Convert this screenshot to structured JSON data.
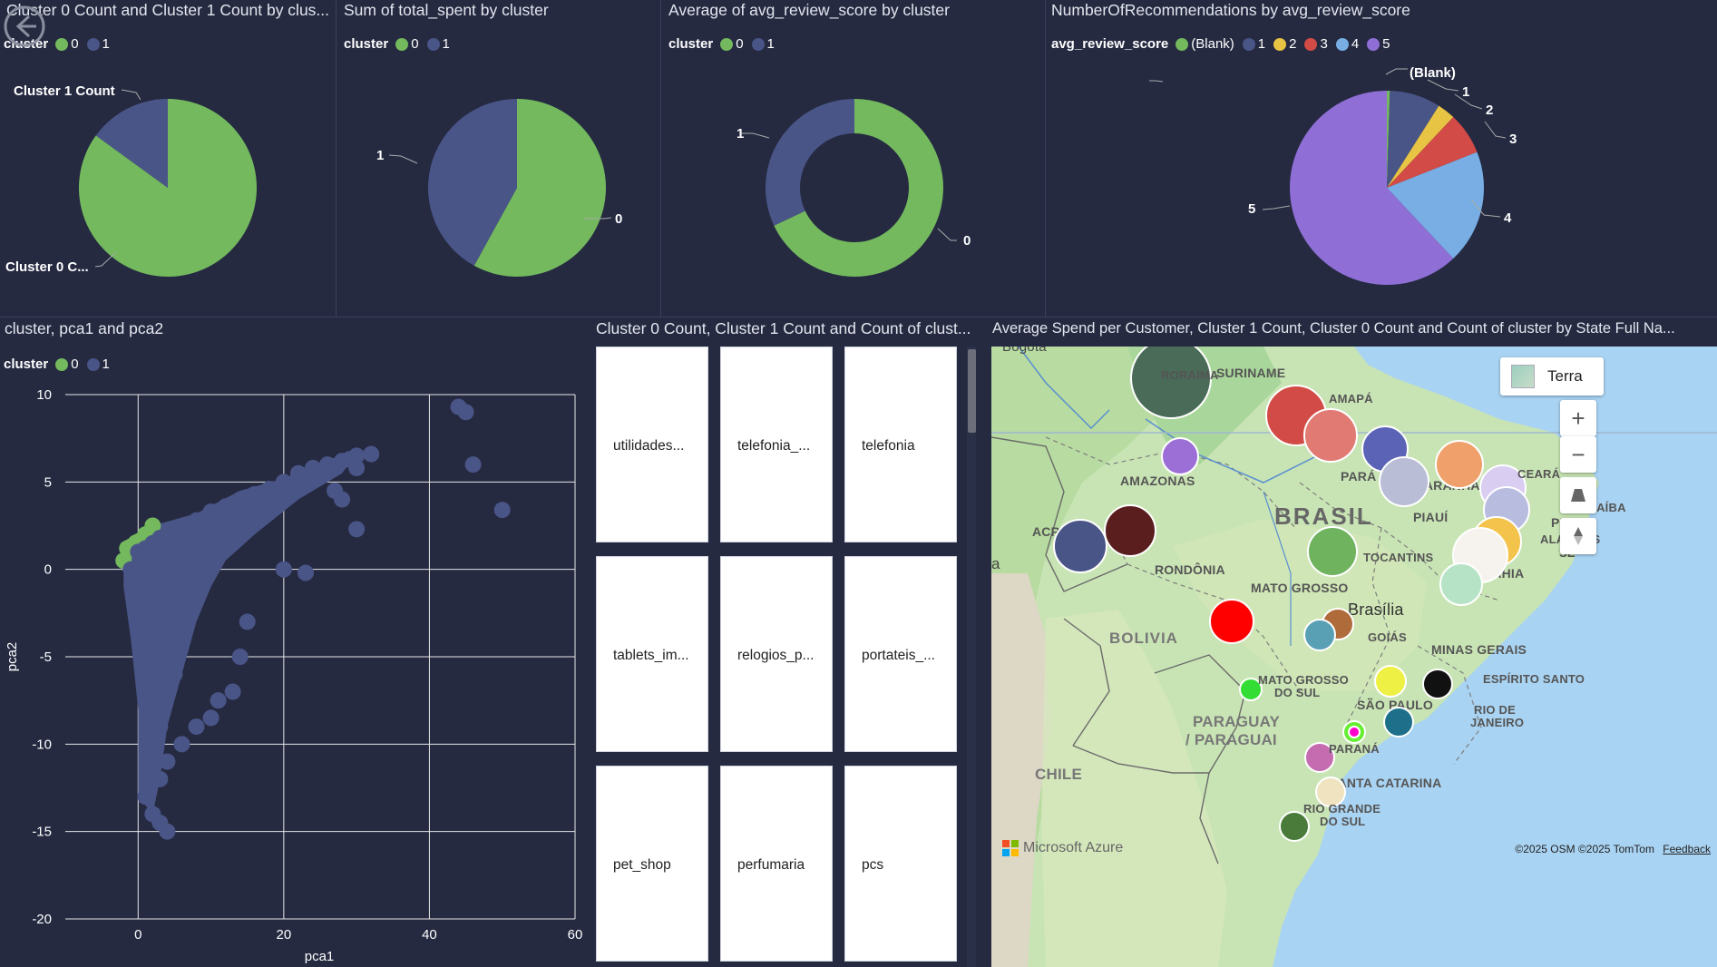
{
  "panel1": {
    "title": "Cluster 0 Count and Cluster 1 Count by clus...",
    "legend_title": "cluster",
    "legend": [
      {
        "label": "0",
        "color": "#74b95e"
      },
      {
        "label": "1",
        "color": "#4a5587"
      }
    ],
    "label_top": "Cluster 1 Count",
    "label_bottom": "Cluster 0 C..."
  },
  "panel2": {
    "title": "Sum of total_spent by cluster",
    "legend_title": "cluster",
    "legend": [
      {
        "label": "0",
        "color": "#74b95e"
      },
      {
        "label": "1",
        "color": "#4a5587"
      }
    ],
    "label_left": "1",
    "label_right": "0"
  },
  "panel3": {
    "title": "Average of avg_review_score by cluster",
    "legend_title": "cluster",
    "legend": [
      {
        "label": "0",
        "color": "#74b95e"
      },
      {
        "label": "1",
        "color": "#4a5587"
      }
    ],
    "label_left": "1",
    "label_right": "0"
  },
  "panel4": {
    "title": "NumberOfRecommendations by avg_review_score",
    "legend_title": "avg_review_score",
    "legend": [
      {
        "label": "(Blank)",
        "color": "#74b95e"
      },
      {
        "label": "1",
        "color": "#4a5587"
      },
      {
        "label": "2",
        "color": "#e8c444"
      },
      {
        "label": "3",
        "color": "#d24b46"
      },
      {
        "label": "4",
        "color": "#78aee3"
      },
      {
        "label": "5",
        "color": "#8f6fd6"
      }
    ],
    "labels": [
      "(Blank)",
      "1",
      "2",
      "3",
      "4",
      "5"
    ]
  },
  "scatter": {
    "title": "cluster, pca1 and pca2",
    "legend_title": "cluster",
    "legend": [
      {
        "label": "0",
        "color": "#74b95e"
      },
      {
        "label": "1",
        "color": "#4a5587"
      }
    ]
  },
  "cards": {
    "title": "Cluster 0 Count, Cluster 1 Count and Count of clust...",
    "items": [
      "utilidades...",
      "telefonia_...",
      "telefonia",
      "tablets_im...",
      "relogios_p...",
      "portateis_...",
      "pet_shop",
      "perfumaria",
      "pcs"
    ]
  },
  "map": {
    "title": "Average Spend per Customer, Cluster 1 Count, Cluster 0 Count and Count of cluster by State Full Na...",
    "style_button": "Terra",
    "zoom_in": "+",
    "zoom_out": "−",
    "attribution": "©2025 OSM  ©2025 TomTom",
    "feedback": "Feedback",
    "logo": "Microsoft Azure",
    "place_labels": {
      "bogota": "Bogotá",
      "suriname": "SURINAME",
      "roraima": "RORAIMA",
      "amapa": "AMAPÁ",
      "amazonas": "AMAZONAS",
      "para": "PARÁ",
      "maranhao": "MARANHÃO",
      "ceara": "CEARÁ",
      "paraiba": "PARAÍBA",
      "brasil": "BRASIL",
      "piaui": "PIAUÍ",
      "pe": "PE",
      "alagoas": "ALAGOAS",
      "se": "SE",
      "acre": "ACRE",
      "rondonia": "RONDÔNIA",
      "tocantins": "TOCANTINS",
      "bahia": "BAHIA",
      "mato_grosso": "MATO GROSSO",
      "brasilia": "Brasília",
      "goias": "GOIÁS",
      "bolivia": "BOLIVIA",
      "minas": "MINAS GERAIS",
      "ms1": "MATO GROSSO",
      "ms2": "DO SUL",
      "espirito": "ESPÍRITO SANTO",
      "sao_paulo": "SÃO PAULO",
      "rj1": "RIO DE",
      "rj2": "JANEIRO",
      "paraguay1": "PARAGUAY",
      "paraguay2": "/ PARAGUAI",
      "parana": "PARANÁ",
      "chile": "CHILE",
      "santa_catarina": "SANTA CATARINA",
      "rgs1": "RIO GRANDE",
      "rgs2": "DO SUL",
      "a": "a"
    }
  },
  "chart_data": [
    {
      "type": "pie",
      "title": "Cluster 0 Count and Cluster 1 Count by clus...",
      "slices": [
        {
          "label": "Cluster 0 Count",
          "value": 85
        },
        {
          "label": "Cluster 1 Count",
          "value": 15
        }
      ]
    },
    {
      "type": "pie",
      "title": "Sum of total_spent by cluster",
      "slices": [
        {
          "label": "0",
          "value": 58
        },
        {
          "label": "1",
          "value": 42
        }
      ]
    },
    {
      "type": "pie",
      "title": "Average of avg_review_score by cluster",
      "slices": [
        {
          "label": "0",
          "value": 68
        },
        {
          "label": "1",
          "value": 32
        }
      ]
    },
    {
      "type": "pie",
      "title": "NumberOfRecommendations by avg_review_score",
      "slices": [
        {
          "label": "(Blank)",
          "value": 0.5
        },
        {
          "label": "1",
          "value": 8.5
        },
        {
          "label": "2",
          "value": 3
        },
        {
          "label": "3",
          "value": 7
        },
        {
          "label": "4",
          "value": 19
        },
        {
          "label": "5",
          "value": 62
        }
      ]
    },
    {
      "type": "scatter",
      "title": "cluster, pca1 and pca2",
      "xlabel": "pca1",
      "ylabel": "pca2",
      "xlim": [
        -10,
        60
      ],
      "ylim": [
        -20,
        10
      ],
      "xticks": [
        0,
        20,
        40,
        60
      ],
      "yticks": [
        -20,
        -15,
        -10,
        -5,
        0,
        5,
        10
      ],
      "series": [
        {
          "name": "0",
          "x": [
            -2,
            -1.5,
            -1,
            0,
            1,
            2,
            2
          ],
          "y": [
            0.5,
            1.2,
            1.3,
            1.5,
            2,
            2,
            2.5
          ]
        },
        {
          "name": "1",
          "x": [
            -1,
            0,
            1,
            2,
            3,
            4,
            5,
            6,
            8,
            10,
            12,
            14,
            16,
            18,
            20,
            22,
            24,
            26,
            28,
            30,
            32,
            29,
            30,
            44,
            45,
            46,
            50,
            30,
            27,
            28,
            20,
            23,
            15,
            14,
            13,
            11,
            10,
            8,
            6,
            4,
            3,
            1,
            2,
            3,
            4,
            2,
            3,
            5,
            6
          ],
          "y": [
            0,
            1,
            1.2,
            1.5,
            1.8,
            2,
            2.2,
            2.4,
            2.8,
            3.3,
            3.6,
            4,
            4.3,
            4.6,
            5,
            5.5,
            5.8,
            6,
            6.2,
            6.5,
            6.6,
            6.3,
            5.8,
            9.3,
            9,
            6,
            3.4,
            2.3,
            4.5,
            4,
            0,
            -0.2,
            -3,
            -5,
            -7,
            -7.5,
            -8.5,
            -9,
            -10,
            -11,
            -12,
            -13,
            -14,
            -14.5,
            -15,
            -10,
            -9,
            -6,
            -4
          ]
        }
      ]
    }
  ]
}
